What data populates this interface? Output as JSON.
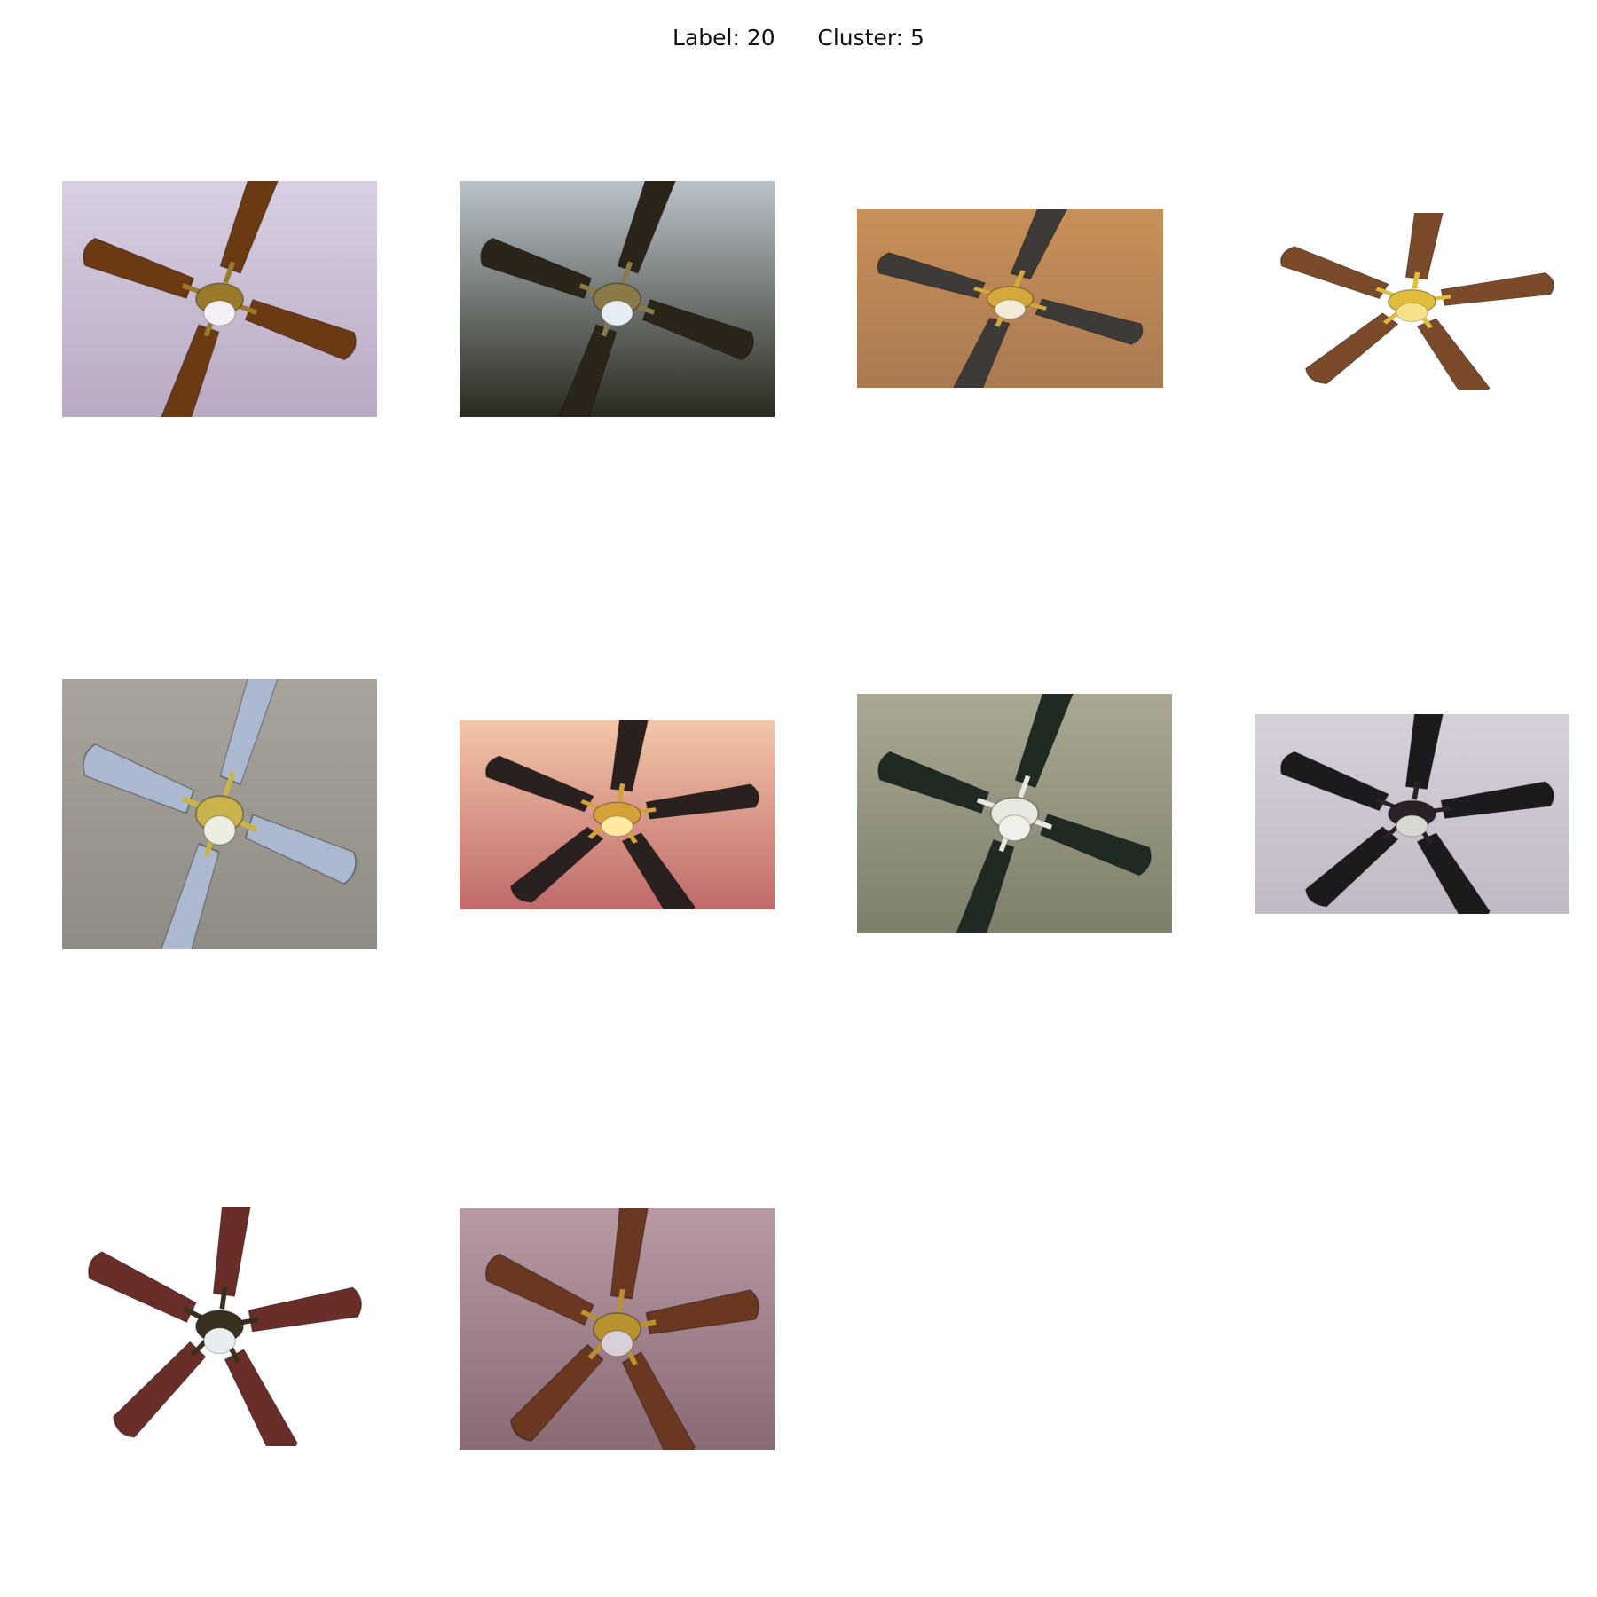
{
  "figure": {
    "label_text": "Label: 20",
    "cluster_text": "Cluster: 5"
  },
  "images": [
    {
      "subject": "ceiling-fan",
      "blades": 4,
      "blade_color": "#6b3a12",
      "bg_top": "#d8cfe2",
      "bg_bottom": "#b9a9c2",
      "hub_color": "#9a7a2a",
      "light": "#f4f0f6"
    },
    {
      "subject": "ceiling-fan",
      "blades": 4,
      "blade_color": "#2b2418",
      "bg_top": "#b9c3c9",
      "bg_bottom": "#2a2b1e",
      "hub_color": "#8a7a4a",
      "light": "#e6edf5"
    },
    {
      "subject": "ceiling-fan",
      "blades": 4,
      "blade_color": "#3d3a38",
      "bg_top": "#c88f58",
      "bg_bottom": "#a87a52",
      "hub_color": "#d3a93b",
      "light": "#f3ead8"
    },
    {
      "subject": "ceiling-fan",
      "blades": 5,
      "blade_color": "#7a4a2a",
      "bg_top": "#ffffff",
      "bg_bottom": "#ffffff",
      "hub_color": "#e0be3c",
      "light": "#f5e18a"
    },
    {
      "subject": "ceiling-fan",
      "blades": 4,
      "blade_color": "#aab9d0",
      "bg_top": "#a8a49c",
      "bg_bottom": "#8f8c85",
      "hub_color": "#c9b34a",
      "light": "#eceee2"
    },
    {
      "subject": "ceiling-fan",
      "blades": 5,
      "blade_color": "#2a2020",
      "bg_top": "#f2c6a8",
      "bg_bottom": "#c06a6a",
      "hub_color": "#d5a23a",
      "light": "#ffe8a0"
    },
    {
      "subject": "ceiling-fan",
      "blades": 4,
      "blade_color": "#1e2a22",
      "bg_top": "#aaa894",
      "bg_bottom": "#7c7f6a",
      "hub_color": "#e8e8e0",
      "light": "#f0f0ea"
    },
    {
      "subject": "ceiling-fan",
      "blades": 5,
      "blade_color": "#1c1a1c",
      "bg_top": "#d5d0da",
      "bg_bottom": "#c0bac6",
      "hub_color": "#2a2226",
      "light": "#d8d8d0"
    },
    {
      "subject": "ceiling-fan",
      "blades": 5,
      "blade_color": "#6a2e2a",
      "bg_top": "#ffffff",
      "bg_bottom": "#ffffff",
      "hub_color": "#3a3020",
      "light": "#e8eef0"
    },
    {
      "subject": "ceiling-fan",
      "blades": 5,
      "blade_color": "#6a3820",
      "bg_top": "#b89aa4",
      "bg_bottom": "#8a6a74",
      "hub_color": "#b8922e",
      "light": "#d8cfd8"
    }
  ]
}
